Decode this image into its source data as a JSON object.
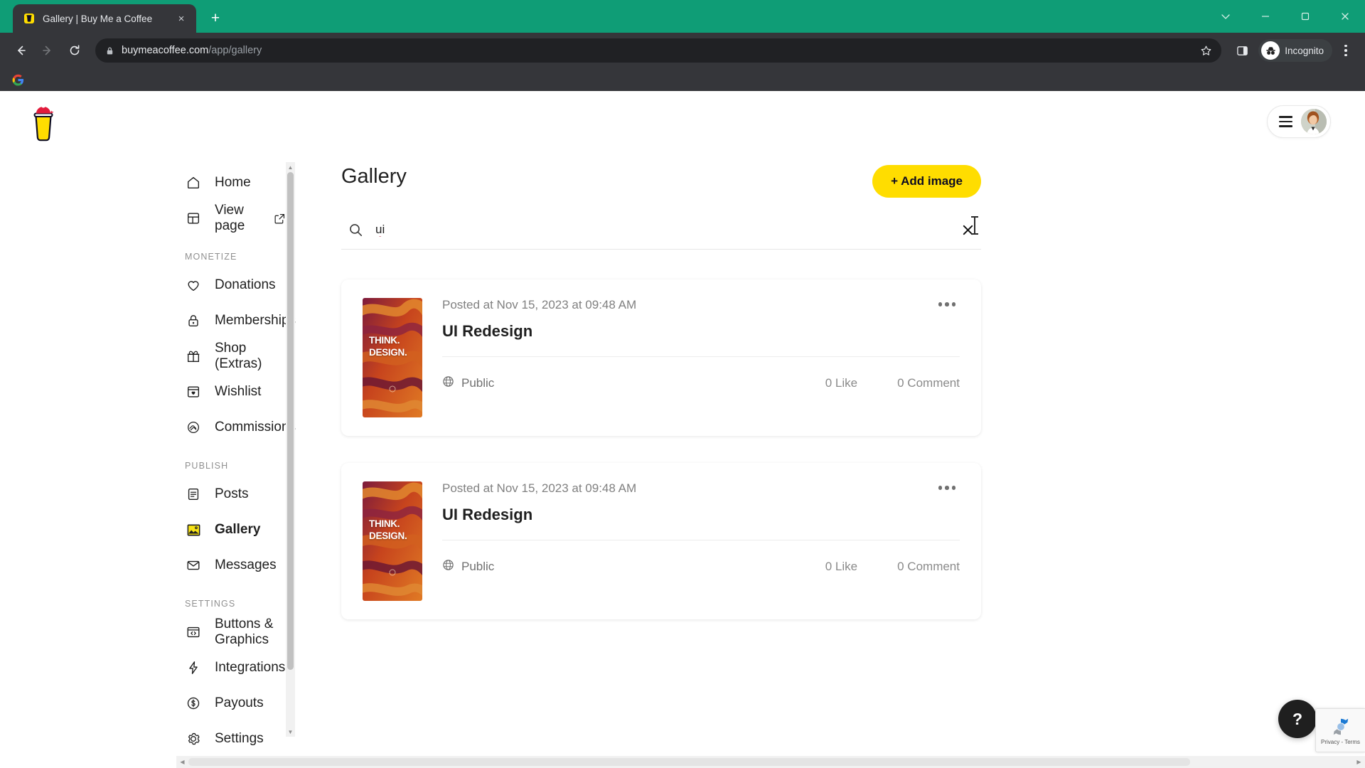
{
  "browser": {
    "tab": {
      "title": "Gallery | Buy Me a Coffee",
      "favicon_name": "coffee-cup-favicon",
      "close_label": "×"
    },
    "new_tab_label": "+",
    "window_controls": {
      "dropdown_label": "⌄",
      "minimize_label": "–",
      "maximize_label": "❐",
      "close_label": "×"
    },
    "toolbar": {
      "back_label": "←",
      "forward_label": "→",
      "reload_label": "↻",
      "url_secure": "buymeacoffee.com",
      "url_path": "/app/gallery",
      "star_label": "☆",
      "side_panel_name": "side-panel-icon",
      "incognito_label": "Incognito",
      "menu_label": "⋮"
    },
    "bookmarks": {
      "first_item_name": "google-bookmark-icon"
    }
  },
  "header": {
    "logo_name": "buymeacoffee-logo",
    "menu_name": "hamburger-menu",
    "avatar_name": "user-avatar"
  },
  "sidebar": {
    "items": [
      {
        "label": "Home",
        "icon": "home-icon",
        "active": false,
        "external": false
      },
      {
        "label": "View page",
        "icon": "layout-icon",
        "active": false,
        "external": true
      }
    ],
    "sections": [
      {
        "title": "MONETIZE",
        "items": [
          {
            "label": "Donations",
            "icon": "heart-icon",
            "active": false
          },
          {
            "label": "Memberships",
            "icon": "lock-icon",
            "active": false
          },
          {
            "label": "Shop (Extras)",
            "icon": "gift-icon",
            "active": false
          },
          {
            "label": "Wishlist",
            "icon": "wishlist-icon",
            "active": false
          },
          {
            "label": "Commissions",
            "icon": "handshake-icon",
            "active": false
          }
        ]
      },
      {
        "title": "PUBLISH",
        "items": [
          {
            "label": "Posts",
            "icon": "document-icon",
            "active": false
          },
          {
            "label": "Gallery",
            "icon": "image-icon",
            "active": true
          },
          {
            "label": "Messages",
            "icon": "envelope-icon",
            "active": false
          }
        ]
      },
      {
        "title": "SETTINGS",
        "items": [
          {
            "label": "Buttons & Graphics",
            "icon": "code-embed-icon",
            "active": false
          },
          {
            "label": "Integrations",
            "icon": "lightning-icon",
            "active": false
          },
          {
            "label": "Payouts",
            "icon": "dollar-circle-icon",
            "active": false
          },
          {
            "label": "Settings",
            "icon": "gear-icon",
            "active": false
          }
        ]
      }
    ]
  },
  "main": {
    "title": "Gallery",
    "add_button_label": "+ Add image",
    "search": {
      "value": "ui",
      "placeholder": "",
      "icon_name": "search-icon",
      "clear_label": "✕"
    },
    "cards": [
      {
        "posted": "Posted at Nov 15, 2023 at 09:48 AM",
        "title": "UI Redesign",
        "thumbnail_text": "THINK.\nDESIGN.",
        "thumbnail_line1": "THINK.",
        "thumbnail_line2": "DESIGN.",
        "visibility": "Public",
        "likes": "0 Like",
        "comments": "0 Comment"
      },
      {
        "posted": "Posted at Nov 15, 2023 at 09:48 AM",
        "title": "UI Redesign",
        "thumbnail_line1": "THINK.",
        "thumbnail_line2": "DESIGN.",
        "visibility": "Public",
        "likes": "0 Like",
        "comments": "0 Comment"
      }
    ]
  },
  "floating": {
    "help_label": "?",
    "recaptcha_label": "Privacy - Terms"
  },
  "colors": {
    "brand_yellow": "#ffdd00",
    "tabstrip_teal": "#0f9d76",
    "chrome_dark": "#35363a",
    "omnibox_dark": "#202124",
    "text_dark": "#1f1f1f"
  }
}
